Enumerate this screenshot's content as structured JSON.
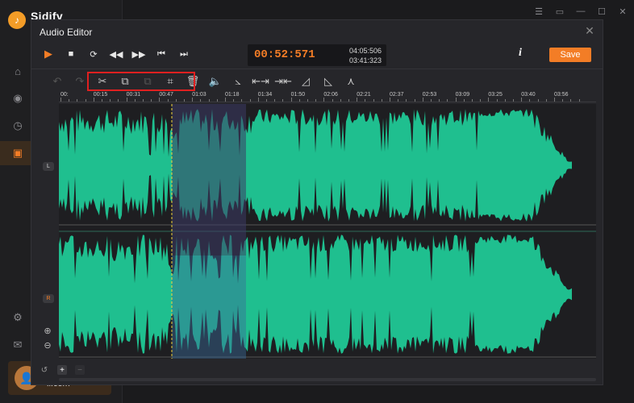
{
  "app": {
    "name": "Sidify",
    "user_email": "il.com"
  },
  "dialog": {
    "title": "Audio Editor",
    "time_current": "00:52:571",
    "time_total_1": "04:05:506",
    "time_total_2": "03:41:323",
    "save_label": "Save",
    "info_label": "i"
  },
  "channels": {
    "left": "L",
    "right": "R"
  },
  "timeline": {
    "ticks": [
      "00:",
      "00:15",
      "00:31",
      "00:47",
      "01:03",
      "01:18",
      "01:34",
      "01:50",
      "02:06",
      "02:21",
      "02:37",
      "02:53",
      "03:09",
      "03:25",
      "03:40",
      "03:56"
    ]
  },
  "colors": {
    "accent": "#f37d26",
    "wave": "#1fbf8f",
    "selection": "#3c3a66",
    "highlight": "#e02020"
  }
}
